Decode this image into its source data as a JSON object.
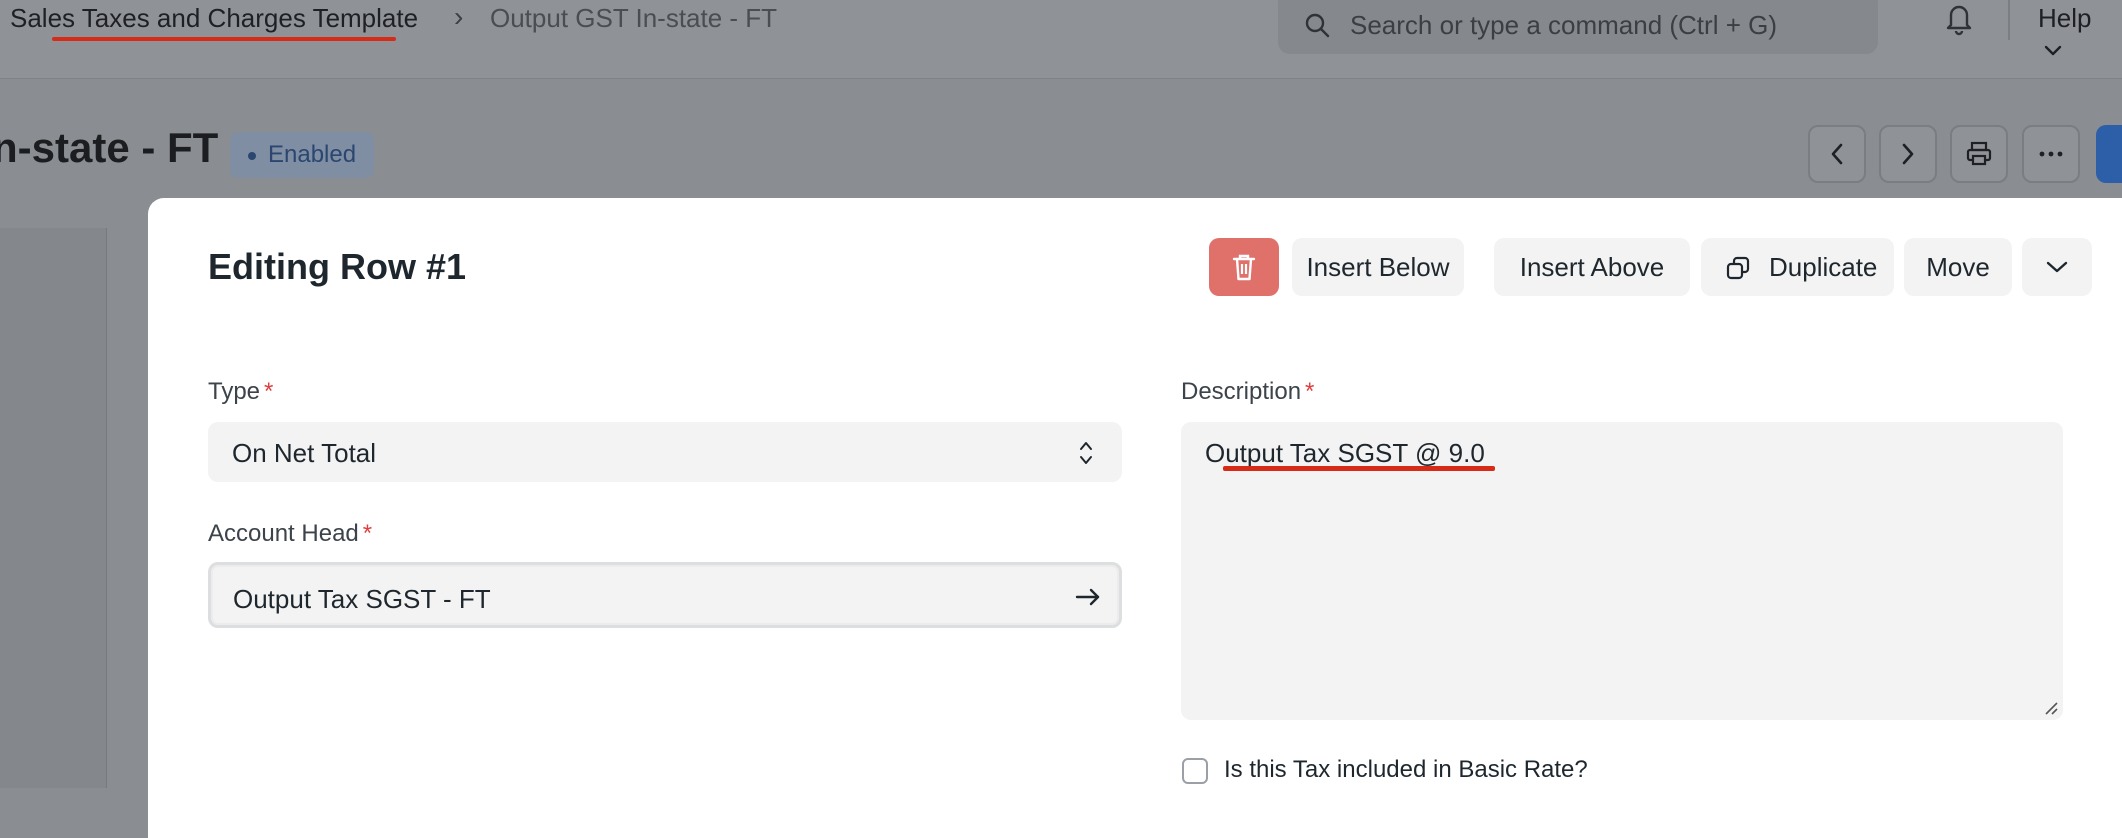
{
  "breadcrumb": {
    "parent": "Sales Taxes and Charges Template",
    "separator": "›",
    "current": "Output GST In-state - FT"
  },
  "navbar": {
    "search_placeholder": "Search or type a command (Ctrl + G)",
    "help_label": "Help",
    "icons": [
      "search-icon",
      "bell-icon",
      "chevron-down-icon"
    ]
  },
  "document": {
    "title": "n-state - FT",
    "status": "Enabled",
    "icons": [
      "chevron-left-icon",
      "chevron-right-icon",
      "printer-icon",
      "more-icon"
    ]
  },
  "modal": {
    "title": "Editing Row #1",
    "buttons": {
      "insert_below": "Insert Below",
      "insert_above": "Insert Above",
      "duplicate": "Duplicate",
      "move": "Move"
    },
    "icons": [
      "trash-icon",
      "duplicate-icon",
      "chevron-down-icon"
    ],
    "fields": {
      "type": {
        "label": "Type",
        "required": "*",
        "value": "On Net Total"
      },
      "account_head": {
        "label": "Account Head",
        "required": "*",
        "value": "Output Tax SGST - FT"
      },
      "description": {
        "label": "Description",
        "required": "*",
        "value": "Output Tax SGST @ 9.0"
      },
      "included_in_basic_rate": {
        "label": "Is this Tax included in Basic Rate?",
        "checked": false
      }
    }
  },
  "colors": {
    "accent": "#2d5ea8",
    "delete_button": "#e0706a",
    "annotation_underline": "#d62c17",
    "required_marker": "#e03e3e"
  }
}
